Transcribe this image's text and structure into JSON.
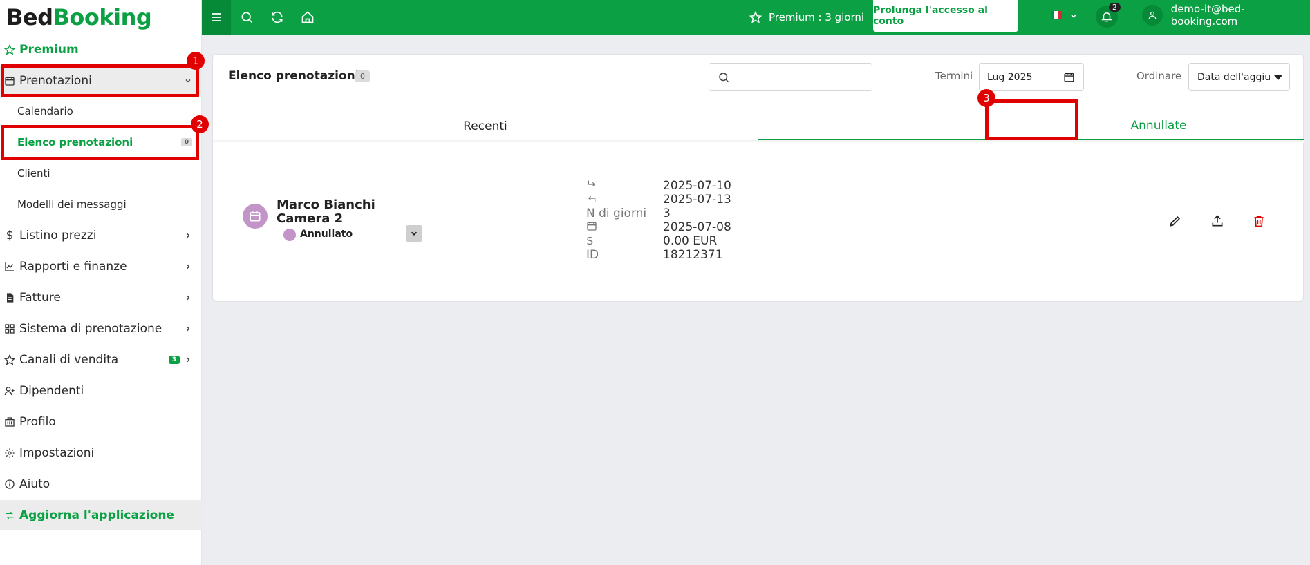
{
  "logo": {
    "part1": "Bed",
    "part2": "Booking"
  },
  "sidebar": {
    "premium": "Premium",
    "bookings": "Prenotazioni",
    "sub": {
      "calendar": "Calendario",
      "list": "Elenco prenotazioni",
      "list_count": "0",
      "clients": "Clienti",
      "templates": "Modelli dei messaggi"
    },
    "prices": "Listino prezzi",
    "reports": "Rapporti e finanze",
    "invoices": "Fatture",
    "booking_system": "Sistema di prenotazione",
    "channels": "Canali di vendita",
    "channels_badge": "3",
    "employees": "Dipendenti",
    "profile": "Profilo",
    "settings": "Impostazioni",
    "help": "Aiuto",
    "update": "Aggiorna l'applicazione"
  },
  "annotations": [
    "1",
    "2",
    "3"
  ],
  "topbar": {
    "premium": "Premium : 3 giorni",
    "extend": "Prolunga l'accesso al conto",
    "notifications": "2",
    "user_email": "demo-it@bed-booking.com"
  },
  "colors": {
    "brand": "#0aa043",
    "annotation": "#e00000",
    "status": "#c294c8",
    "delete": "#e00000"
  },
  "list": {
    "title": "Elenco prenotazioni",
    "count": "0",
    "search_placeholder": "",
    "term_label": "Termini",
    "month": "Lug 2025",
    "sort_label": "Ordinare",
    "sort_value": "Data dell'aggiu",
    "tabs": {
      "recent": "Recenti",
      "cancelled": "Annullate"
    }
  },
  "booking": {
    "name": "Marco Bianchi",
    "room": "Camera 2",
    "status": "Annullato",
    "nights_label": "N di giorni",
    "id_label": "ID",
    "currency_label": "$",
    "checkin": "2025-07-10",
    "checkout": "2025-07-13",
    "nights": "3",
    "created": "2025-07-08",
    "price": "0.00 EUR",
    "id": "18212371"
  }
}
